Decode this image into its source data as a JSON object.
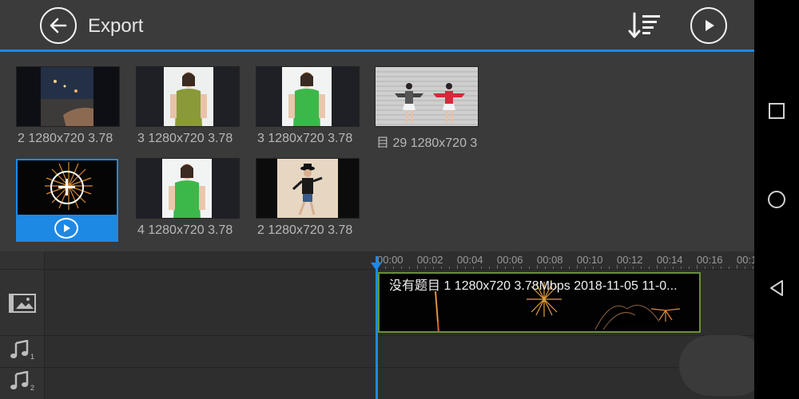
{
  "header": {
    "title": "Export",
    "back_icon": "back-arrow-icon",
    "sort_icon": "sort-icon",
    "play_icon": "play-icon"
  },
  "library": {
    "clips": [
      {
        "caption": "2 1280x720 3.78",
        "thumb": "night-city"
      },
      {
        "caption": "3 1280x720 3.78",
        "thumb": "girl-olive-shirt"
      },
      {
        "caption": "3 1280x720 3.78",
        "thumb": "girl-green-shirt"
      },
      {
        "caption": "目 29 1280x720 3",
        "thumb": "two-girls-shutter"
      },
      {
        "caption": "",
        "thumb": "fireworks-selected",
        "add_icon": "add-icon",
        "play_icon": "play-icon"
      },
      {
        "caption": "4 1280x720 3.78",
        "thumb": "girl-green-shirt"
      },
      {
        "caption": "2 1280x720 3.78",
        "thumb": "child-dancing"
      }
    ]
  },
  "timeline": {
    "ticks": [
      "00:00",
      "00:02",
      "00:04",
      "00:06",
      "00:08",
      "00:10",
      "00:12",
      "00:14",
      "00:16",
      "00:1"
    ],
    "clip_title": "没有题目 1 1280x720 3.78Mbps 2018-11-05 11-0...",
    "tracks": [
      {
        "icon": "video-image-track-icon",
        "sub": ""
      },
      {
        "icon": "music-note-icon",
        "sub": "1"
      },
      {
        "icon": "music-note-icon",
        "sub": "2"
      }
    ]
  },
  "colors": {
    "accent": "#1e88e5",
    "clip_border": "#6a8f3a"
  },
  "nav": {
    "recents_icon": "square-icon",
    "home_icon": "circle-icon",
    "back_icon": "triangle-back-icon"
  }
}
